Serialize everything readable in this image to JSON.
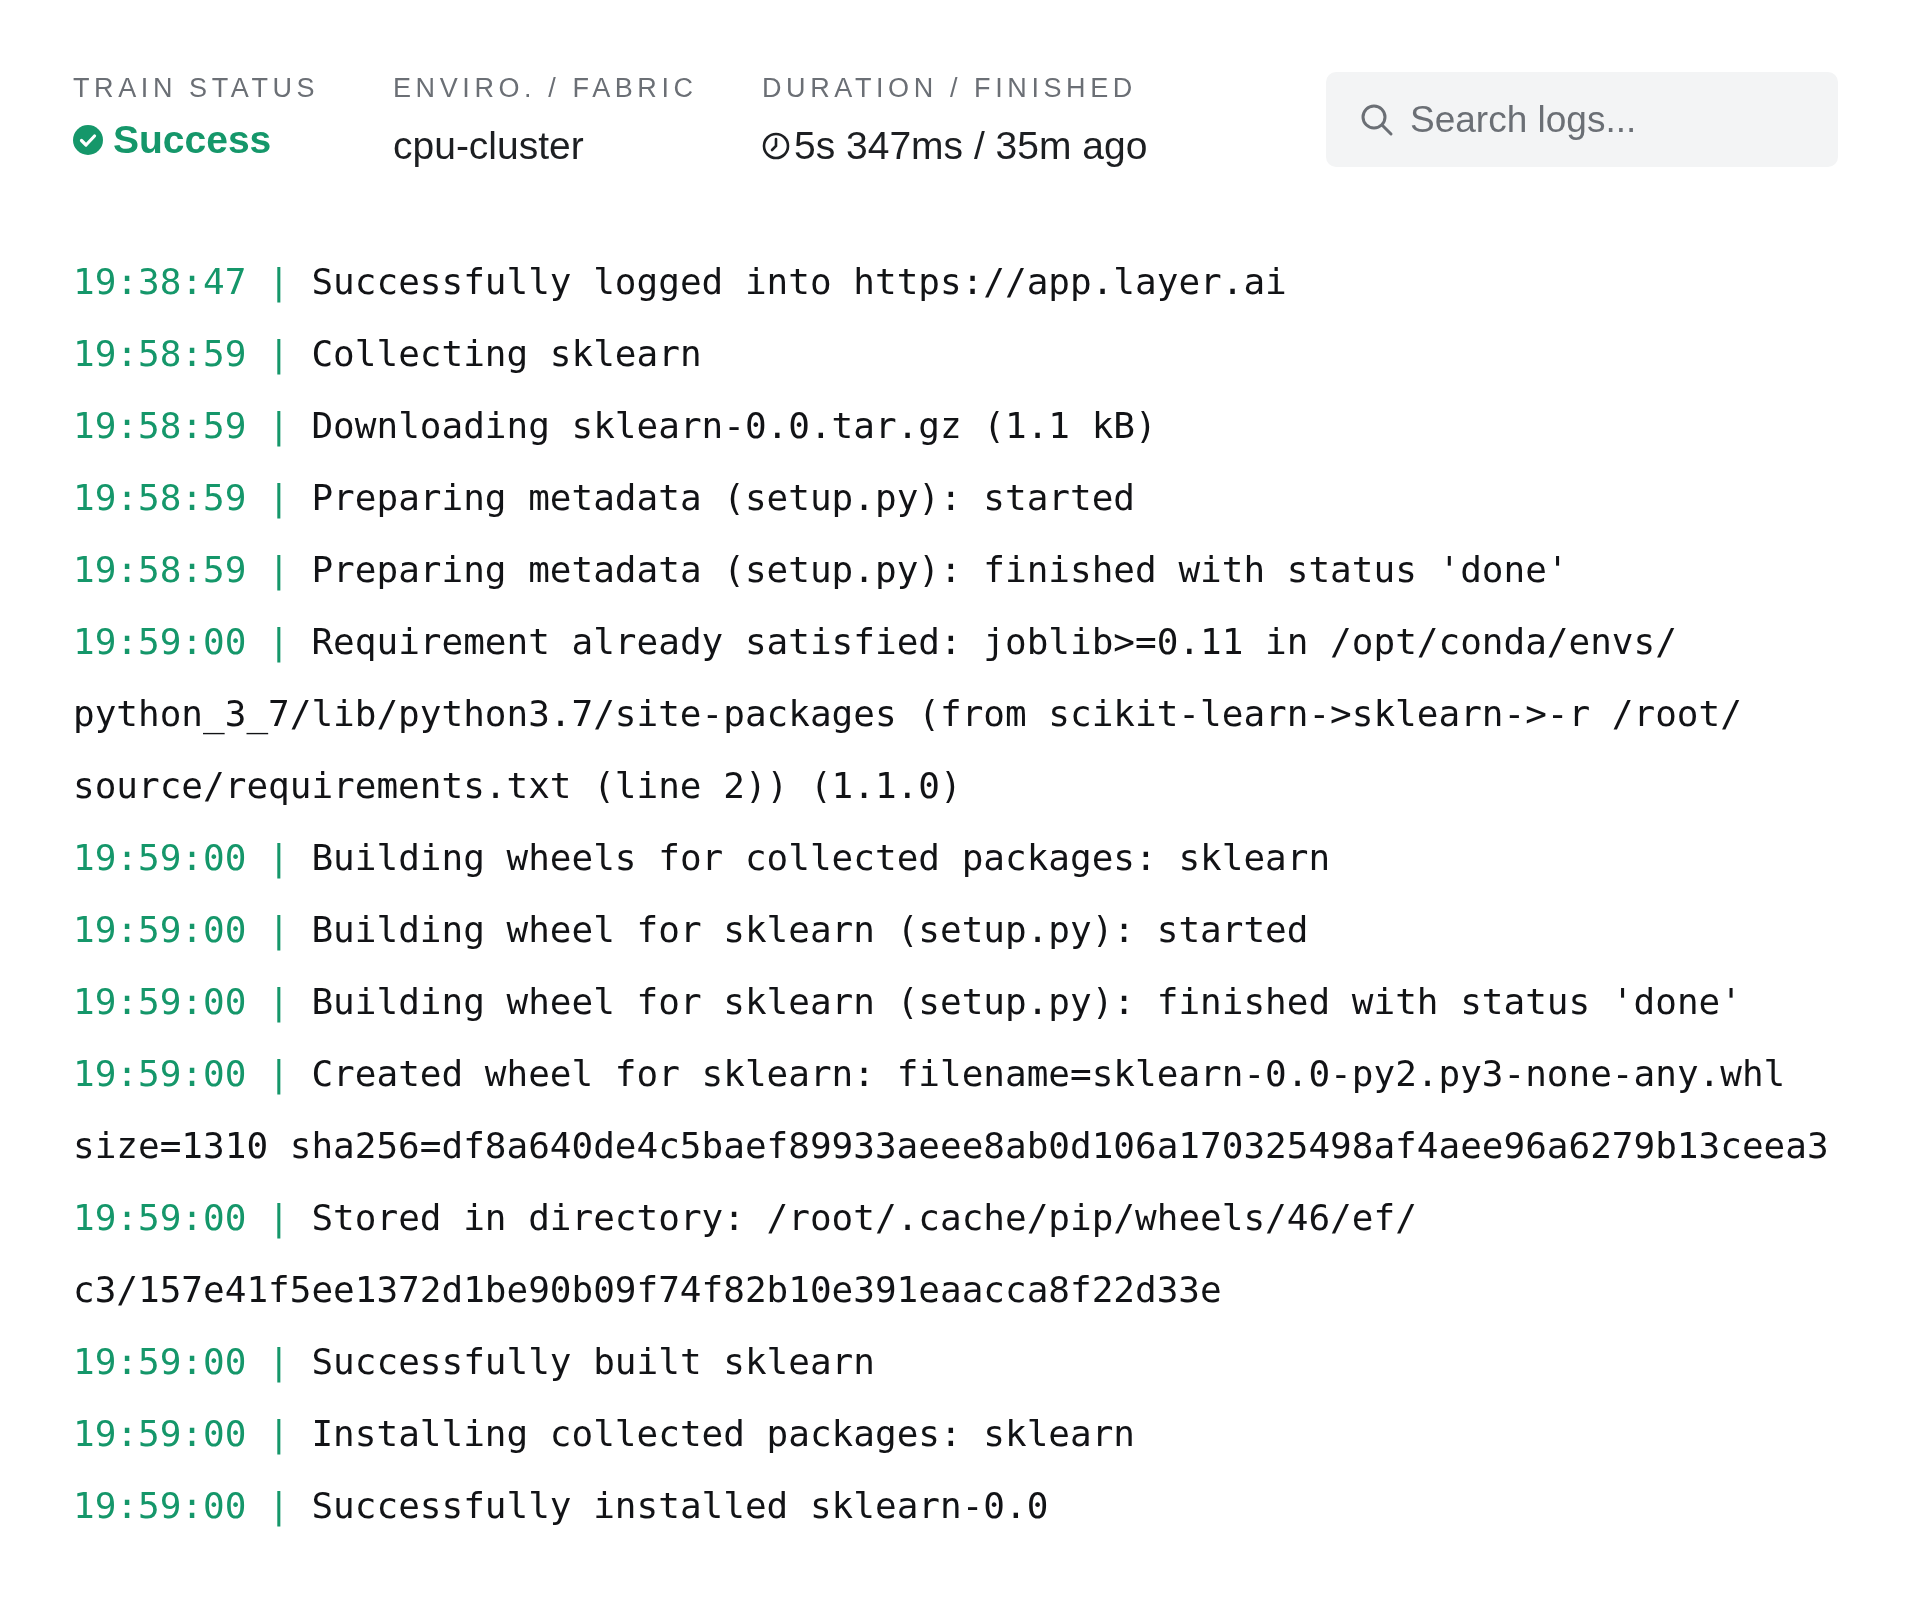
{
  "header": {
    "fields": [
      {
        "kind": "success",
        "label": "TRAIN STATUS",
        "value": "Success"
      },
      {
        "kind": "text",
        "label": "ENVIRO. / FABRIC",
        "value": "cpu-cluster"
      },
      {
        "kind": "duration",
        "label": "DURATION / FINISHED",
        "value": "5s 347ms / 35m ago"
      }
    ],
    "search": {
      "placeholder": "Search logs..."
    }
  },
  "logs": [
    {
      "time": "19:38:47 |",
      "message": "Successfully logged into https://app.layer.ai"
    },
    {
      "time": "19:58:59 |",
      "message": "Collecting sklearn"
    },
    {
      "time": "19:58:59 |",
      "message": "Downloading sklearn-0.0.tar.gz (1.1 kB)"
    },
    {
      "time": "19:58:59 |",
      "message": "Preparing metadata (setup.py): started"
    },
    {
      "time": "19:58:59 |",
      "message": "Preparing metadata (setup.py): finished with status 'done'"
    },
    {
      "time": "19:59:00 |",
      "message": "Requirement already satisfied: joblib>=0.11 in /opt/conda/envs/\npython_3_7/lib/python3.7/site-packages (from scikit-learn->sklearn->-r /root/\nsource/requirements.txt (line 2)) (1.1.0)"
    },
    {
      "time": "19:59:00 |",
      "message": "Building wheels for collected packages: sklearn"
    },
    {
      "time": "19:59:00 |",
      "message": "Building wheel for sklearn (setup.py): started"
    },
    {
      "time": "19:59:00 |",
      "message": "Building wheel for sklearn (setup.py): finished with status 'done'"
    },
    {
      "time": "19:59:00 |",
      "message": "Created wheel for sklearn: filename=sklearn-0.0-py2.py3-none-any.whl\nsize=1310 sha256=df8a640de4c5baef89933aeee8ab0d106a170325498af4aee96a6279b13ceea3"
    },
    {
      "time": "19:59:00 |",
      "message": "Stored in directory: /root/.cache/pip/wheels/46/ef/\nc3/157e41f5ee1372d1be90b09f74f82b10e391eaacca8f22d33e"
    },
    {
      "time": "19:59:00 |",
      "message": "Successfully built sklearn"
    },
    {
      "time": "19:59:00 |",
      "message": "Installing collected packages: sklearn"
    },
    {
      "time": "19:59:00 |",
      "message": "Successfully installed sklearn-0.0"
    }
  ]
}
